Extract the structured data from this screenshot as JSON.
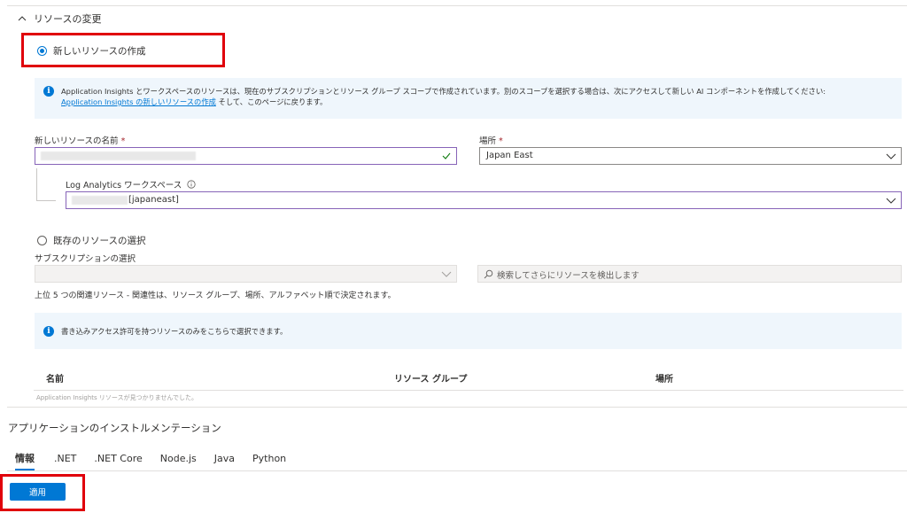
{
  "change_resource": {
    "header": "リソースの変更"
  },
  "new_resource": {
    "radio_label": "新しいリソースの作成",
    "info_line1": "Application Insights とワークスペースのリソースは、現在のサブスクリプションとリソース グループ スコープで作成されています。別のスコープを選択する場合は、次にアクセスして新しい AI コンポーネントを作成してください:",
    "info_link": "Application Insights の新しいリソースの作成",
    "info_line2_suffix": " そして、このページに戻ります。",
    "name_label": "新しいリソースの名前",
    "required_mark": "*",
    "location_label": "場所",
    "location_value": "Japan East",
    "workspace_label": "Log Analytics ワークスペース",
    "workspace_value": "[japaneast]"
  },
  "existing_resource": {
    "radio_label": "既存のリソースの選択",
    "subscription_label": "サブスクリプションの選択",
    "search_placeholder": "検索してさらにリソースを検出します",
    "top5_text": "上位 5 つの関連リソース - 関連性は、リソース グループ、場所、アルファベット順で決定されます。",
    "info_text": "書き込みアクセス許可を持つリソースのみをこちらで選択できます。",
    "table_headers": [
      "名前",
      "リソース グループ",
      "場所"
    ],
    "empty_text": "Application Insights リソースが見つかりませんでした。"
  },
  "instrumentation": {
    "title": "アプリケーションのインストルメンテーション",
    "tabs": [
      "情報",
      ".NET",
      ".NET Core",
      "Node.js",
      "Java",
      "Python"
    ]
  },
  "apply_label": "適用",
  "colors": {
    "accent": "#0078d4",
    "highlight": "#e0000b",
    "info_bg": "#eff6fc"
  }
}
